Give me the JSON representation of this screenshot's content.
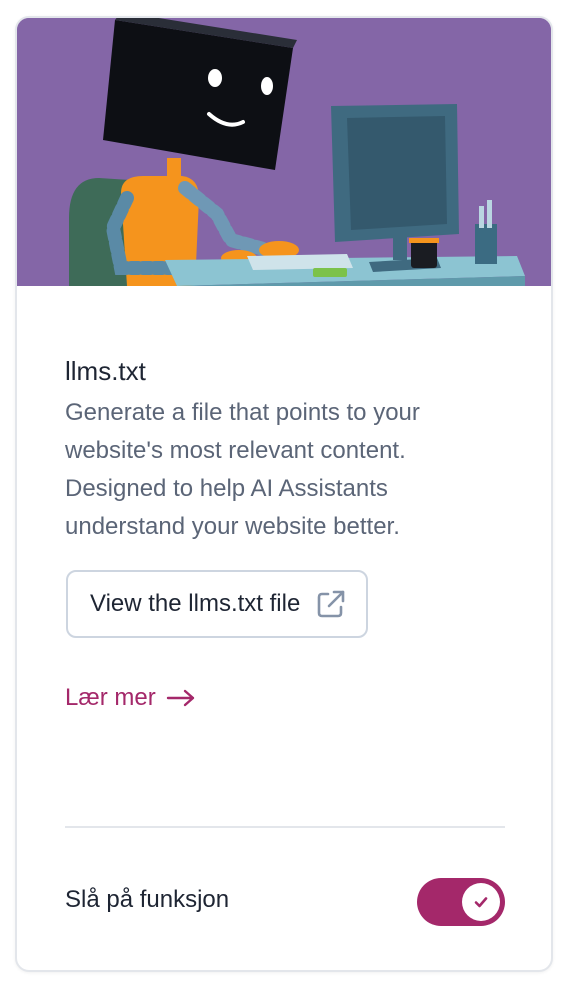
{
  "card": {
    "illustration": "robot-at-computer-illustration",
    "title": "llms.txt",
    "description": "Generate a file that points to your website's most relevant content. Designed to help AI Assistants understand your website better.",
    "view_button_label": "View the llms.txt file",
    "view_button_icon": "external-link-icon",
    "learn_more_label": "Lær mer",
    "learn_more_icon": "arrow-right-icon",
    "toggle_label": "Slå på funksjon",
    "toggle_on": true,
    "toggle_icon": "check-icon"
  },
  "colors": {
    "accent": "#a4286a",
    "hero_background": "#8466a7",
    "text_primary": "#1e2533",
    "text_secondary": "#5b6577",
    "border": "#e3e6eb"
  }
}
